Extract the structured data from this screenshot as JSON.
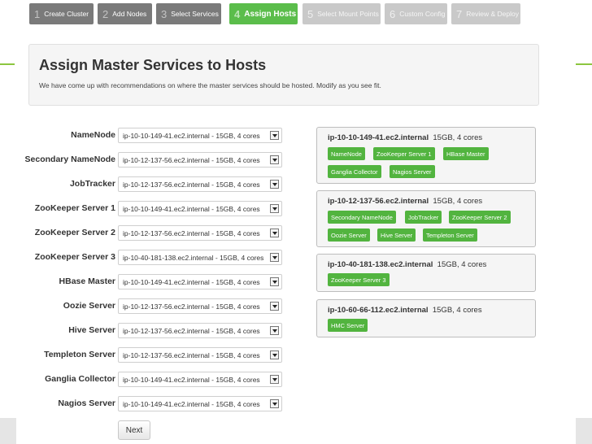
{
  "steps": [
    {
      "num": "1",
      "label": "Create Cluster",
      "state": "done"
    },
    {
      "num": "2",
      "label": "Add Nodes",
      "state": "done"
    },
    {
      "num": "3",
      "label": "Select Services",
      "state": "done"
    },
    {
      "num": "4",
      "label": "Assign Hosts",
      "state": "current"
    },
    {
      "num": "5",
      "label": "Select Mount Points",
      "state": "future"
    },
    {
      "num": "6",
      "label": "Custom Config",
      "state": "future"
    },
    {
      "num": "7",
      "label": "Review & Deploy",
      "state": "future"
    }
  ],
  "header": {
    "title": "Assign Master Services to Hosts",
    "description": "We have come up with recommendations on where the master services should be hosted. Modify as you see fit."
  },
  "assignments": [
    {
      "service": "NameNode",
      "host": "ip-10-10-149-41.ec2.internal - 15GB, 4 cores"
    },
    {
      "service": "Secondary NameNode",
      "host": "ip-10-12-137-56.ec2.internal - 15GB, 4 cores"
    },
    {
      "service": "JobTracker",
      "host": "ip-10-12-137-56.ec2.internal - 15GB, 4 cores"
    },
    {
      "service": "ZooKeeper Server 1",
      "host": "ip-10-10-149-41.ec2.internal - 15GB, 4 cores"
    },
    {
      "service": "ZooKeeper Server 2",
      "host": "ip-10-12-137-56.ec2.internal - 15GB, 4 cores"
    },
    {
      "service": "ZooKeeper Server 3",
      "host": "ip-10-40-181-138.ec2.internal - 15GB, 4 cores"
    },
    {
      "service": "HBase Master",
      "host": "ip-10-10-149-41.ec2.internal - 15GB, 4 cores"
    },
    {
      "service": "Oozie Server",
      "host": "ip-10-12-137-56.ec2.internal - 15GB, 4 cores"
    },
    {
      "service": "Hive Server",
      "host": "ip-10-12-137-56.ec2.internal - 15GB, 4 cores"
    },
    {
      "service": "Templeton Server",
      "host": "ip-10-12-137-56.ec2.internal - 15GB, 4 cores"
    },
    {
      "service": "Ganglia Collector",
      "host": "ip-10-10-149-41.ec2.internal - 15GB, 4 cores"
    },
    {
      "service": "Nagios Server",
      "host": "ip-10-10-149-41.ec2.internal - 15GB, 4 cores"
    }
  ],
  "hosts": [
    {
      "name": "ip-10-10-149-41.ec2.internal",
      "specs": "15GB, 4 cores",
      "services": [
        "NameNode",
        "ZooKeeper Server 1",
        "HBase Master",
        "Ganglia Collector",
        "Nagios Server"
      ]
    },
    {
      "name": "ip-10-12-137-56.ec2.internal",
      "specs": "15GB, 4 cores",
      "services": [
        "Secondary NameNode",
        "JobTracker",
        "ZooKeeper Server 2",
        "Oozie Server",
        "Hive Server",
        "Templeton Server"
      ]
    },
    {
      "name": "ip-10-40-181-138.ec2.internal",
      "specs": "15GB, 4 cores",
      "services": [
        "ZooKeeper Server 3"
      ]
    },
    {
      "name": "ip-10-60-66-112.ec2.internal",
      "specs": "15GB, 4 cores",
      "services": [
        "HMC Server"
      ]
    }
  ],
  "actions": {
    "next_label": "Next"
  },
  "colors": {
    "accent": "#5bbd4b",
    "badge": "#52b43f",
    "step_done": "#7a7a7a",
    "step_future": "#c9c9c9"
  }
}
